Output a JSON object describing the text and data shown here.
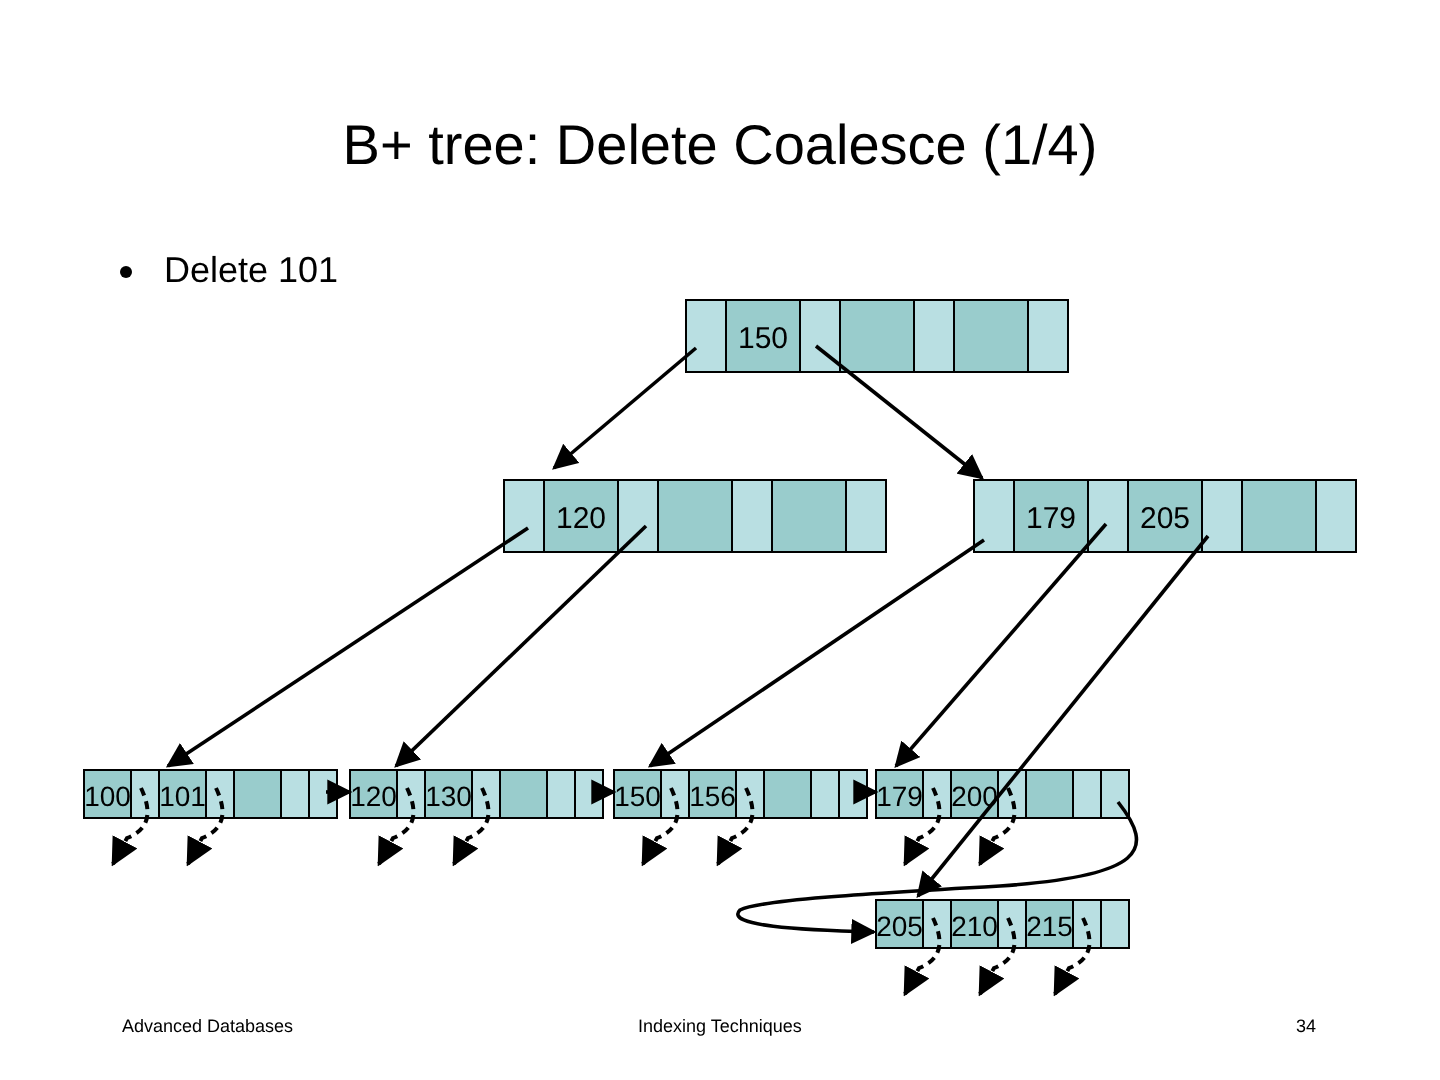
{
  "title": "B+ tree: Delete Coalesce (1/4)",
  "bullets": [
    "Delete 101"
  ],
  "tree": {
    "root": {
      "keys": [
        "150"
      ]
    },
    "internal": [
      {
        "keys": [
          "120"
        ]
      },
      {
        "keys": [
          "179",
          "205"
        ]
      }
    ],
    "leaves": [
      {
        "keys": [
          "100",
          "101"
        ]
      },
      {
        "keys": [
          "120",
          "130"
        ]
      },
      {
        "keys": [
          "150",
          "156"
        ]
      },
      {
        "keys": [
          "179",
          "200"
        ]
      },
      {
        "keys": [
          "205",
          "210",
          "215"
        ]
      }
    ]
  },
  "footer": {
    "left": "Advanced Databases",
    "center": "Indexing Techniques",
    "page_number": "34"
  }
}
